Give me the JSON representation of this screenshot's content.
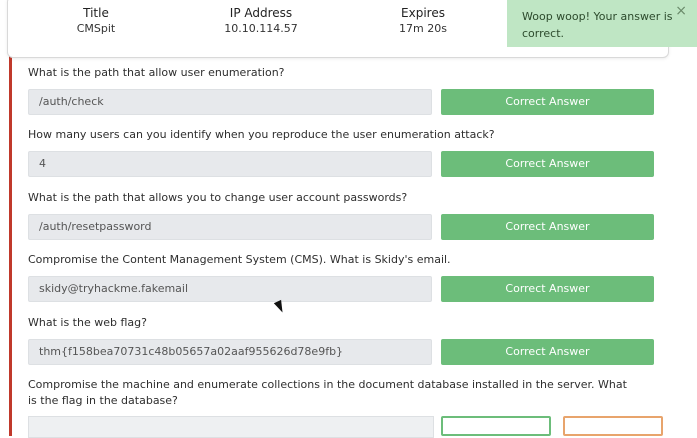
{
  "machine_info": {
    "title": {
      "label": "Title",
      "value": "CMSpit"
    },
    "ip": {
      "label": "IP Address",
      "value": "10.10.114.57"
    },
    "expires": {
      "label": "Expires",
      "value": "17m 20s"
    }
  },
  "toast": {
    "message": "Woop woop! Your answer is correct.",
    "close": "×"
  },
  "questions": [
    {
      "question": "What is the path that allow user enumeration?",
      "answer": "/auth/check",
      "button": "Correct Answer"
    },
    {
      "question": "How many users can you identify when you reproduce the user enumeration attack?",
      "answer": "4",
      "button": "Correct Answer"
    },
    {
      "question": "What is the path that allows you to change user account passwords?",
      "answer": "/auth/resetpassword",
      "button": "Correct Answer"
    },
    {
      "question": "Compromise the Content Management System (CMS). What is Skidy's email.",
      "answer": "skidy@tryhackme.fakemail",
      "button": "Correct Answer"
    },
    {
      "question": "What is the web flag?",
      "answer": "thm{f158bea70731c48b05657a02aaf955626d78e9fb}",
      "button": "Correct Answer"
    },
    {
      "question": "Compromise the machine and enumerate collections in the document database installed in the server. What is the flag in the database?"
    }
  ],
  "colors": {
    "accent_red": "#c0392b",
    "correct_green": "#6cbd7a",
    "toast_bg": "#bfe6c4"
  }
}
